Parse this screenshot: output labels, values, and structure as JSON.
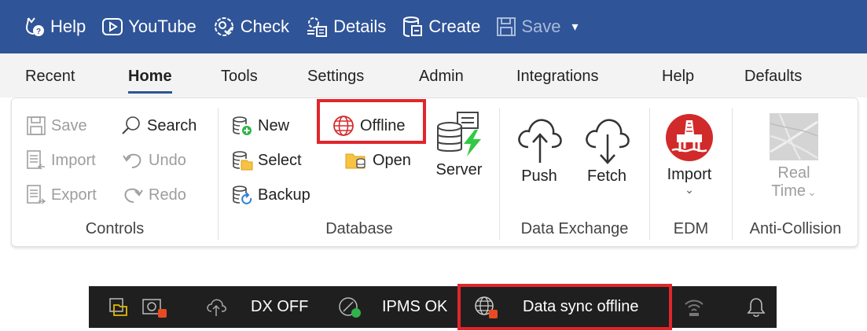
{
  "qat": {
    "help": "Help",
    "youtube": "YouTube",
    "check": "Check",
    "details": "Details",
    "create": "Create",
    "save": "Save",
    "more": "▾"
  },
  "tabs": [
    "Recent",
    "Home",
    "Tools",
    "Settings",
    "Admin",
    "Integrations",
    "Help",
    "Defaults"
  ],
  "ribbon": {
    "controls": {
      "label": "Controls",
      "save": "Save",
      "search": "Search",
      "import": "Import",
      "undo": "Undo",
      "export": "Export",
      "redo": "Redo"
    },
    "database": {
      "label": "Database",
      "new": "New",
      "offline": "Offline",
      "select": "Select",
      "open": "Open",
      "backup": "Backup",
      "server": "Server"
    },
    "data_exchange": {
      "label": "Data Exchange",
      "push": "Push",
      "fetch": "Fetch"
    },
    "edm": {
      "label": "EDM",
      "import": "Import"
    },
    "anti_collision": {
      "label": "Anti-Collision",
      "real": "Real",
      "time": "Time"
    }
  },
  "status": {
    "dx": "DX OFF",
    "ipms": "IPMS OK",
    "sync": "Data sync offline"
  },
  "colors": {
    "title_bar": "#2f5497",
    "highlight": "#e0262c",
    "status_bar": "#1f1f1f",
    "status_ok": "#2fb34a",
    "status_error": "#e84b23"
  }
}
